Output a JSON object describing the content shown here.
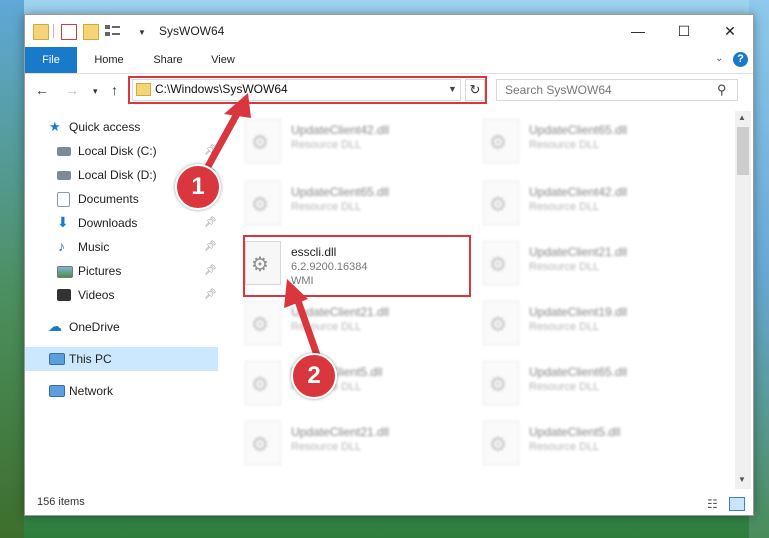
{
  "titlebar": {
    "title": "SysWOW64",
    "min": "—",
    "max": "☐",
    "close": "✕"
  },
  "ribbon": {
    "tabs": [
      "File",
      "Home",
      "Share",
      "View"
    ],
    "help": "?"
  },
  "nav": {
    "back": "←",
    "forward": "→",
    "recent": "▾",
    "up": "↑",
    "address": "C:\\Windows\\SysWOW64",
    "refresh": "↻",
    "search_placeholder": "Search SysWOW64"
  },
  "sidebar": {
    "items": [
      {
        "label": "Quick access"
      },
      {
        "label": "Local Disk (C:)"
      },
      {
        "label": "Local Disk (D:)"
      },
      {
        "label": "Documents"
      },
      {
        "label": "Downloads"
      },
      {
        "label": "Music"
      },
      {
        "label": "Pictures"
      },
      {
        "label": "Videos"
      },
      {
        "label": "OneDrive"
      },
      {
        "label": "This PC"
      },
      {
        "label": "Network"
      }
    ]
  },
  "files": {
    "left": [
      {
        "name": "UpdateClient42.dll",
        "type": "Resource DLL"
      },
      {
        "name": "UpdateClient65.dll",
        "type": "Resource DLL"
      },
      {
        "name": "UpdateClient21.dll",
        "type": "Resource DLL"
      },
      {
        "name": "UpdateClient5.dll",
        "type": "Resource DLL"
      },
      {
        "name": "UpdateClient21.dll",
        "type": "Resource DLL"
      }
    ],
    "right": [
      {
        "name": "UpdateClient65.dll",
        "type": "Resource DLL"
      },
      {
        "name": "UpdateClient42.dll",
        "type": "Resource DLL"
      },
      {
        "name": "UpdateClient21.dll",
        "type": "Resource DLL"
      },
      {
        "name": "UpdateClient19.dll",
        "type": "Resource DLL"
      },
      {
        "name": "UpdateClient65.dll",
        "type": "Resource DLL"
      },
      {
        "name": "UpdateClient5.dll",
        "type": "Resource DLL"
      }
    ],
    "highlight": {
      "name": "esscli.dll",
      "version": "6.2.9200.16384",
      "description": "WMI"
    }
  },
  "status": {
    "items": "156 items"
  },
  "callouts": {
    "one": "1",
    "two": "2"
  },
  "colors": {
    "accent": "#1979ca",
    "highlight": "#d9363e",
    "selection": "#cce8ff"
  }
}
